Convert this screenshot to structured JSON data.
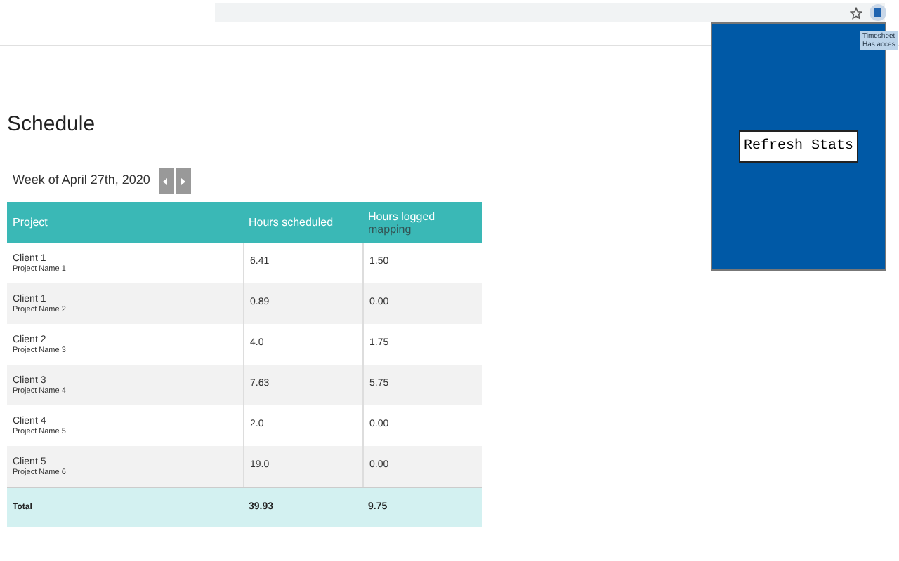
{
  "tooltip": {
    "lines": [
      "Timesheet",
      "Has acces"
    ]
  },
  "popup": {
    "button": "Refresh Stats"
  },
  "page": {
    "title": "Schedule",
    "week": "Week of April 27th, 2020"
  },
  "table": {
    "columns": [
      {
        "label": "Project"
      },
      {
        "label": "Hours scheduled"
      },
      {
        "label": "Hours logged",
        "sub": "mapping"
      }
    ],
    "rows": [
      {
        "client": "Client 1",
        "project": "Project Name 1",
        "scheduled": "6.41",
        "logged": "1.50"
      },
      {
        "client": "Client 1",
        "project": "Project Name 2",
        "scheduled": "0.89",
        "logged": "0.00"
      },
      {
        "client": "Client 2",
        "project": "Project Name 3",
        "scheduled": "4.0",
        "logged": "1.75"
      },
      {
        "client": "Client 3",
        "project": "Project Name 4",
        "scheduled": "7.63",
        "logged": "5.75"
      },
      {
        "client": "Client 4",
        "project": "Project Name 5",
        "scheduled": "2.0",
        "logged": "0.00"
      },
      {
        "client": "Client 5",
        "project": "Project Name 6",
        "scheduled": "19.0",
        "logged": "0.00"
      }
    ],
    "total": {
      "label": "Total",
      "scheduled": "39.93",
      "logged": "9.75"
    }
  }
}
